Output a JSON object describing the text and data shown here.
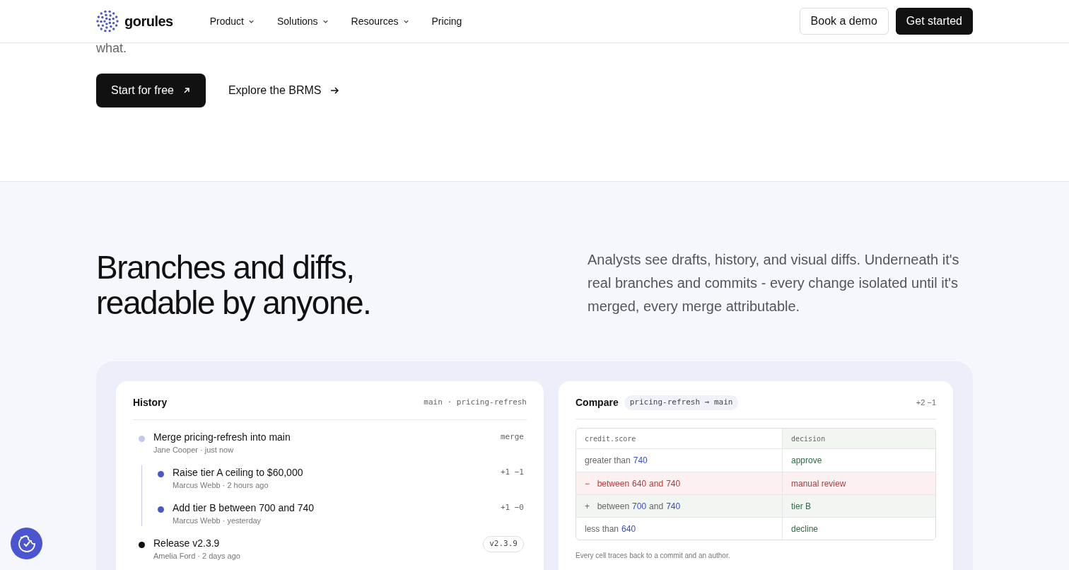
{
  "nav": {
    "brand": "gorules",
    "links": [
      {
        "label": "Product",
        "dropdown": true
      },
      {
        "label": "Solutions",
        "dropdown": true
      },
      {
        "label": "Resources",
        "dropdown": true
      },
      {
        "label": "Pricing",
        "dropdown": false
      }
    ],
    "book_demo": "Book a demo",
    "get_started": "Get started"
  },
  "hero": {
    "text_tail": "what.",
    "primary": "Start for free",
    "secondary": "Explore the BRMS"
  },
  "section": {
    "heading": "Branches and diffs, readable by anyone.",
    "description": "Analysts see drafts, history, and visual diffs. Underneath it's real branches and commits - every change isolated until it's merged, every merge attributable."
  },
  "history": {
    "title": "History",
    "branches": "main · pricing-refresh",
    "items": [
      {
        "kind": "merge",
        "title": "Merge pricing-refresh into main",
        "meta": "Jane Cooper · just now",
        "badge": "merge",
        "children": [
          {
            "kind": "commit",
            "title": "Raise tier A ceiling to $60,000",
            "meta": "Marcus Webb · 2 hours ago",
            "badge": "+1 −1"
          },
          {
            "kind": "commit",
            "title": "Add tier B between 700 and 740",
            "meta": "Marcus Webb · yesterday",
            "badge": "+1 −0"
          }
        ]
      },
      {
        "kind": "release",
        "title": "Release v2.3.9",
        "meta": "Amelia Ford · 2 days ago",
        "badge": "v2.3.9"
      }
    ]
  },
  "compare": {
    "title": "Compare",
    "ref": "pricing-refresh → main",
    "stat": "+2 −1",
    "columns": [
      "credit.score",
      "decision"
    ],
    "rows": [
      {
        "kind": "unchanged",
        "condition": [
          {
            "kind": "text",
            "text": "greater than"
          },
          {
            "kind": "value",
            "text": "740"
          }
        ],
        "decision": "approve"
      },
      {
        "kind": "removed",
        "marker": "−",
        "condition": [
          {
            "kind": "text",
            "text": "between"
          },
          {
            "kind": "value",
            "text": "640"
          },
          {
            "kind": "text",
            "text": "and"
          },
          {
            "kind": "value",
            "text": "740"
          }
        ],
        "decision": "manual review"
      },
      {
        "kind": "added",
        "marker": "+",
        "condition": [
          {
            "kind": "text",
            "text": "between"
          },
          {
            "kind": "value",
            "text": "700"
          },
          {
            "kind": "text",
            "text": "and"
          },
          {
            "kind": "value",
            "text": "740"
          }
        ],
        "decision": "tier B"
      },
      {
        "kind": "unchanged",
        "condition": [
          {
            "kind": "text",
            "text": "less than"
          },
          {
            "kind": "value",
            "text": "640"
          }
        ],
        "decision": "decline"
      }
    ],
    "footnote": "Every cell traces back to a commit and an author."
  }
}
